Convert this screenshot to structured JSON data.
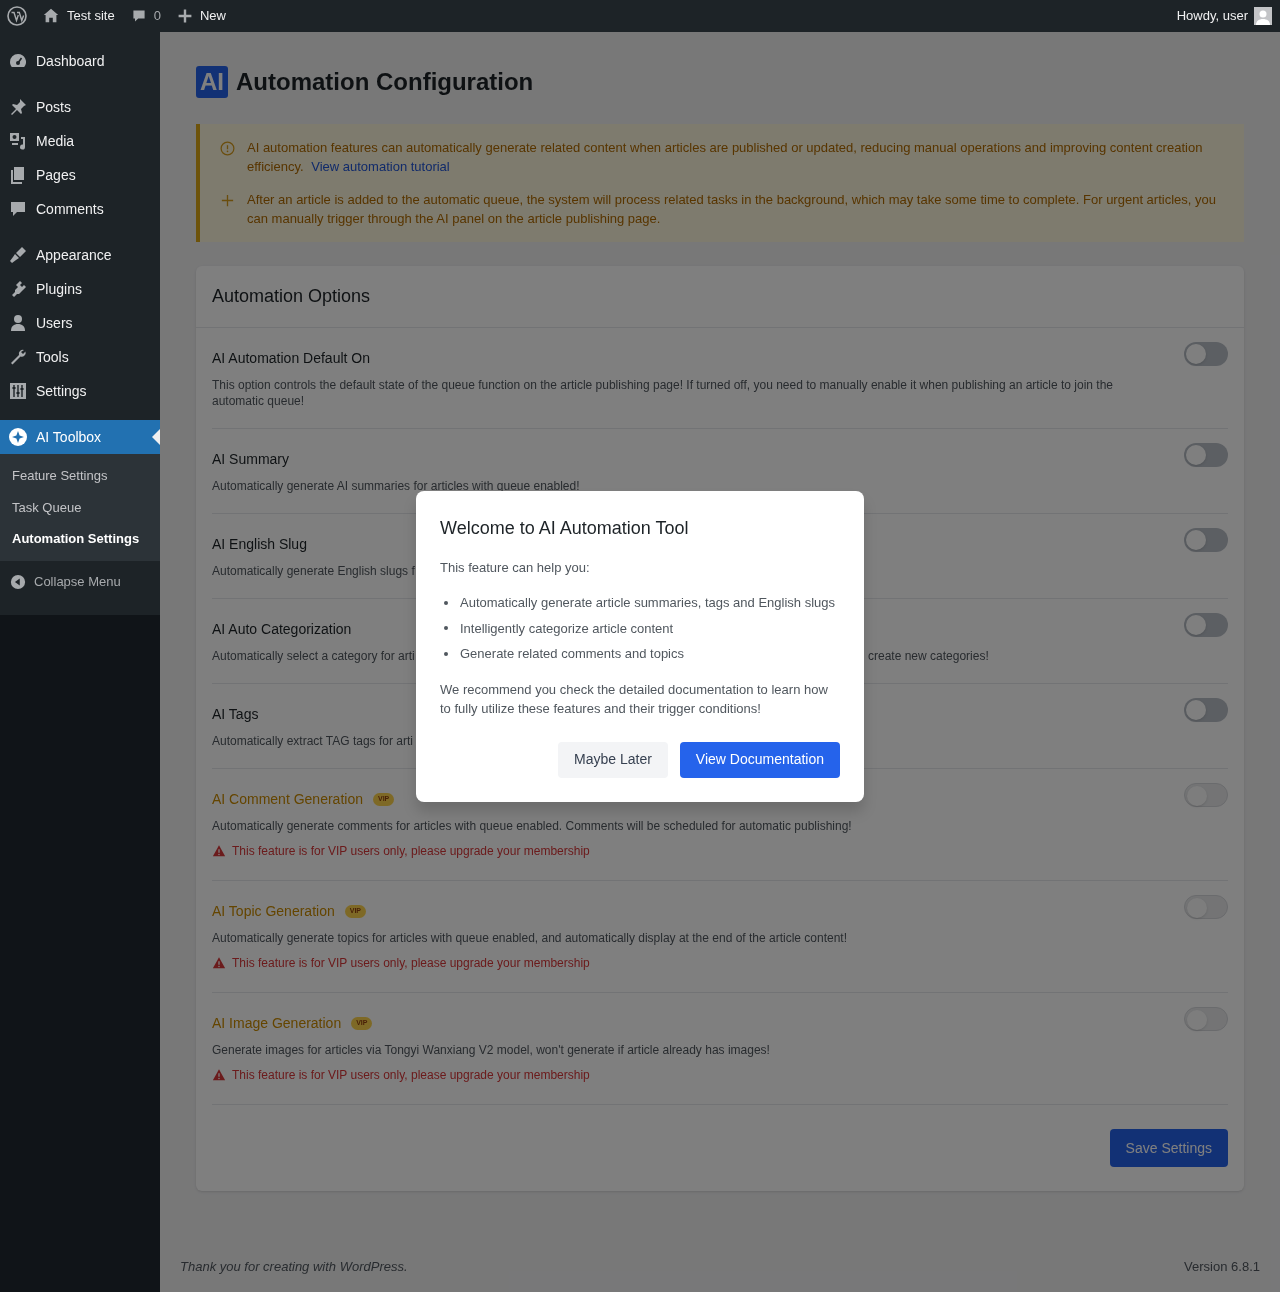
{
  "admin_bar": {
    "site": "Test site",
    "comments": "0",
    "new": "New",
    "greeting": "Howdy, user"
  },
  "sidebar": {
    "sections": [
      {
        "items": [
          {
            "label": "Dashboard",
            "selected": false
          }
        ]
      },
      {
        "items": [
          {
            "label": "Posts",
            "selected": false
          },
          {
            "label": "Media",
            "selected": false
          },
          {
            "label": "Pages",
            "selected": false
          },
          {
            "label": "Comments",
            "selected": false
          }
        ]
      },
      {
        "items": [
          {
            "label": "Appearance",
            "selected": false
          },
          {
            "label": "Plugins",
            "selected": false
          },
          {
            "label": "Users",
            "selected": false
          },
          {
            "label": "Tools",
            "selected": false
          },
          {
            "label": "Settings",
            "selected": false
          }
        ]
      },
      {
        "items": [
          {
            "label": "AI Toolbox",
            "selected": true,
            "submenu": [
              {
                "label": "Feature Settings",
                "selected": false
              },
              {
                "label": "Task Queue",
                "selected": false
              },
              {
                "label": "Automation Settings",
                "selected": true
              }
            ]
          }
        ]
      }
    ],
    "collapse": "Collapse Menu"
  },
  "page": {
    "badge": "AI",
    "title": "Automation Configuration"
  },
  "notice": {
    "items": [
      {
        "kind": "info",
        "text": "AI automation features can automatically generate related content when articles are published or updated, reducing manual operations and improving content creation efficiency.",
        "link": "View automation tutorial"
      },
      {
        "kind": "tip",
        "text": "After an article is added to the automatic queue, the system will process related tasks in the background, which may take some time to complete. For urgent articles, you can manually trigger through the AI panel on the article publishing page."
      }
    ]
  },
  "options": {
    "title": "Automation Options",
    "rows": [
      {
        "title": "AI Automation Default On",
        "description": "This option controls the default state of the queue function on the article publishing page! If turned off, you need to manually enable it when publishing an article to join the automatic queue!",
        "on": false,
        "disabled": false
      },
      {
        "title": "AI Summary",
        "description": "Automatically generate AI summaries for articles with queue enabled!",
        "on": false,
        "disabled": false
      },
      {
        "title": "AI English Slug",
        "description": "Automatically generate English slugs f",
        "on": false,
        "disabled": false
      },
      {
        "title": "AI Auto Categorization",
        "description": "Automatically select a category for arti",
        "description_right": "create new categories!",
        "on": false,
        "disabled": false
      },
      {
        "title": "AI Tags",
        "description": "Automatically extract TAG tags for arti",
        "on": false,
        "disabled": false
      },
      {
        "title": "AI Comment Generation",
        "badge": "VIP",
        "description": "Automatically generate comments for articles with queue enabled. Comments will be scheduled for automatic publishing!",
        "warning": "This feature is for VIP users only, please upgrade your membership",
        "on": false,
        "disabled": true
      },
      {
        "title": "AI Topic Generation",
        "badge": "VIP",
        "description": "Automatically generate topics for articles with queue enabled, and automatically display at the end of the article content!",
        "warning": "This feature is for VIP users only, please upgrade your membership",
        "on": false,
        "disabled": true
      },
      {
        "title": "AI Image Generation",
        "badge": "VIP",
        "description": "Generate images for articles via Tongyi Wanxiang V2 model, won't generate if article already has images!",
        "warning": "This feature is for VIP users only, please upgrade your membership",
        "on": false,
        "disabled": true
      }
    ],
    "save": "Save Settings"
  },
  "footer": {
    "left": "Thank you for creating with WordPress.",
    "right": "Version 6.8.1"
  },
  "modal": {
    "title": "Welcome to AI Automation Tool",
    "intro": "This feature can help you:",
    "bullets": [
      "Automatically generate article summaries, tags and English slugs",
      "Intelligently categorize article content",
      "Generate related comments and topics"
    ],
    "note": "We recommend you check the detailed documentation to learn how to fully utilize these features and their trigger conditions!",
    "buttons": [
      {
        "label": "Maybe Later",
        "kind": "secondary"
      },
      {
        "label": "View Documentation",
        "kind": "primary"
      }
    ]
  }
}
